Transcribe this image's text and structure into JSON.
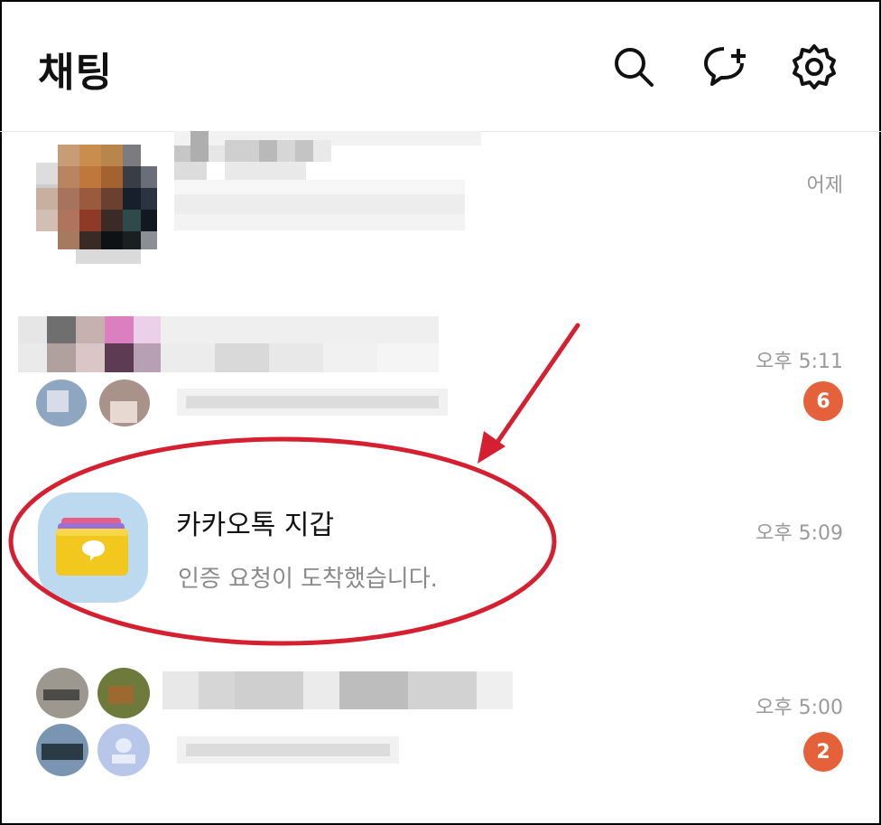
{
  "header": {
    "title": "채팅",
    "icons": [
      "search-icon",
      "new-chat-icon",
      "settings-icon"
    ]
  },
  "chats": [
    {
      "time": "어제"
    },
    {
      "time": "오후 5:11",
      "unread": "6"
    },
    {
      "name": "카카오톡 지갑",
      "message": "인증 요청이 도착했습니다.",
      "time": "오후 5:09"
    },
    {
      "time": "오후 5:00",
      "unread": "2"
    }
  ],
  "colors": {
    "badge": "#e5613b",
    "annotation": "#d42030",
    "wallet_bg": "#bcd9ef",
    "wallet_card": "#f2c81e"
  }
}
